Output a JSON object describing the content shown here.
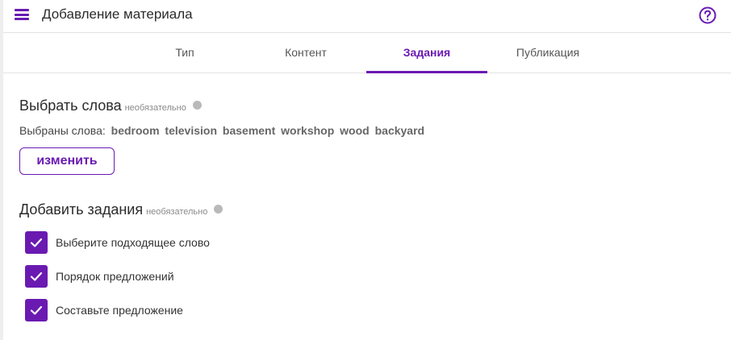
{
  "header": {
    "title": "Добавление материала",
    "menu_icon": "hamburger-menu-icon",
    "help_icon": "question-circle-icon"
  },
  "tabs": [
    {
      "label": "Тип",
      "active": false
    },
    {
      "label": "Контент",
      "active": false
    },
    {
      "label": "Задания",
      "active": true
    },
    {
      "label": "Публикация",
      "active": false
    }
  ],
  "words_section": {
    "title": "Выбрать слова",
    "optional": "необязательно",
    "selected_prefix": "Выбраны слова:",
    "words": [
      "bedroom",
      "television",
      "basement",
      "workshop",
      "wood",
      "backyard"
    ],
    "change_button": "изменить"
  },
  "tasks_section": {
    "title": "Добавить задания",
    "optional": "необязательно",
    "tasks": [
      {
        "label": "Выберите подходящее слово",
        "checked": true
      },
      {
        "label": "Порядок предложений",
        "checked": true
      },
      {
        "label": "Составьте предложение",
        "checked": true
      }
    ]
  },
  "colors": {
    "accent": "#6a1ab1",
    "background": "#eeeeee",
    "info_dot": "#b9b9b9"
  }
}
